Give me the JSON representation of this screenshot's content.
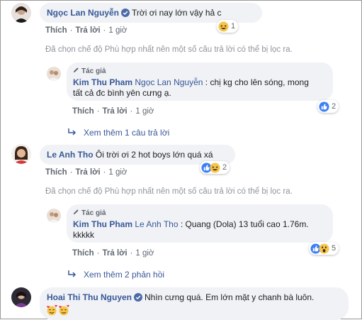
{
  "comments": [
    {
      "author": "Ngọc Lan Nguyễn",
      "text": "Trời ơi nay lớn vậy hả c",
      "actions": {
        "like": "Thích",
        "reply": "Trả lời",
        "time": "1 giờ"
      },
      "reaction_count": "1",
      "filter_note": "Đã chọn chế độ Phù hợp nhất nên một số câu trả lời có thể bị lọc ra.",
      "reply": {
        "author_tag": "Tác giả",
        "author": "Kim Thu Pham",
        "mention": "Ngọc Lan Nguyễn",
        "text_line1": ": chị kg cho lên sóng, mong",
        "text_line2": "tất cả đc bình yên cưng ạ.",
        "actions": {
          "like": "Thích",
          "reply": "Trả lời",
          "time": "1 giờ"
        },
        "reaction_count": "2"
      },
      "more_replies": "Xem thêm 1 câu trả lời"
    },
    {
      "author": "Le Anh Tho",
      "text": "Ôi trời ơi 2 hot boys lớn quá xá",
      "actions": {
        "like": "Thích",
        "reply": "Trả lời",
        "time": "1 giờ"
      },
      "reaction_count": "2",
      "filter_note": "Đã chọn chế độ Phù hợp nhất nên một số câu trả lời có thể bị lọc ra.",
      "reply": {
        "author_tag": "Tác giả",
        "author": "Kim Thu Pham",
        "mention": "Le Anh Tho",
        "text_line1": ": Quang (Dola) 13 tuổi cao 1.76m.",
        "text_line2": "kkkkk",
        "actions": {
          "like": "Thích",
          "reply": "Trả lời",
          "time": "1 giờ"
        },
        "reaction_count": "5"
      },
      "more_replies": "Xem thêm 2 phản hồi"
    },
    {
      "author": "Hoai Thi Thu Nguyen",
      "text": "Nhìn cưng quá. Em lớn mặt y chanh bà luôn."
    }
  ],
  "colors": {
    "link": "#385898",
    "bubble": "#f0f2f5",
    "meta": "#606770",
    "note": "#90949c"
  }
}
